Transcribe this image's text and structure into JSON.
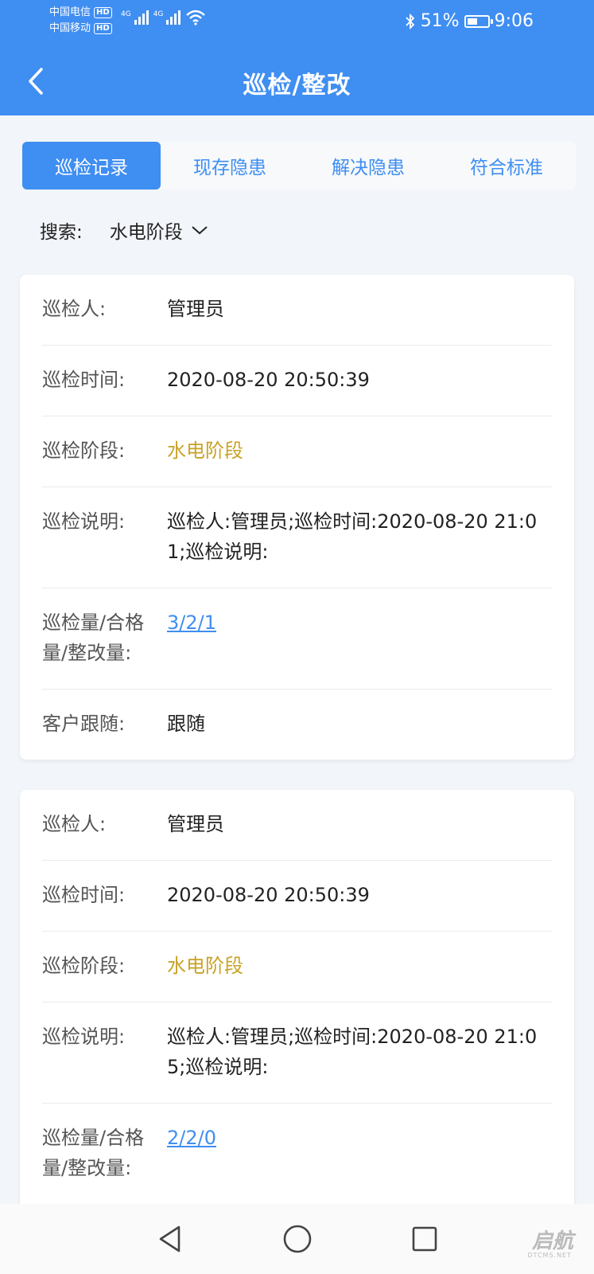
{
  "status_bar": {
    "carrier1": "中国电信",
    "carrier2": "中国移动",
    "hd": "HD",
    "net1": "4G",
    "net2": "4G",
    "battery": "51%",
    "battery_level": 0.51,
    "time": "9:06"
  },
  "header": {
    "title": "巡检/整改"
  },
  "tabs": [
    {
      "label": "巡检记录",
      "active": true
    },
    {
      "label": "现存隐患",
      "active": false
    },
    {
      "label": "解决隐患",
      "active": false
    },
    {
      "label": "符合标准",
      "active": false
    }
  ],
  "search": {
    "label": "搜索:",
    "value": "水电阶段"
  },
  "labels": {
    "inspector": "巡检人:",
    "time": "巡检时间:",
    "stage": "巡检阶段:",
    "note": "巡检说明:",
    "counts": "巡检量/合格量/整改量:",
    "follow": "客户跟随:"
  },
  "records": [
    {
      "inspector": "管理员",
      "time": "2020-08-20 20:50:39",
      "stage": "水电阶段",
      "note": "巡检人:管理员;巡检时间:2020-08-20 21:01;巡检说明:",
      "counts": "3/2/1",
      "follow": "跟随"
    },
    {
      "inspector": "管理员",
      "time": "2020-08-20 20:50:39",
      "stage": "水电阶段",
      "note": "巡检人:管理员;巡检时间:2020-08-20 21:05;巡检说明:",
      "counts": "2/2/0"
    }
  ],
  "watermark": {
    "text": "启航",
    "sub": "DTCMS.NET"
  },
  "colors": {
    "primary": "#3f8ef2",
    "stage": "#c9a227",
    "background": "#f2f5f9"
  }
}
